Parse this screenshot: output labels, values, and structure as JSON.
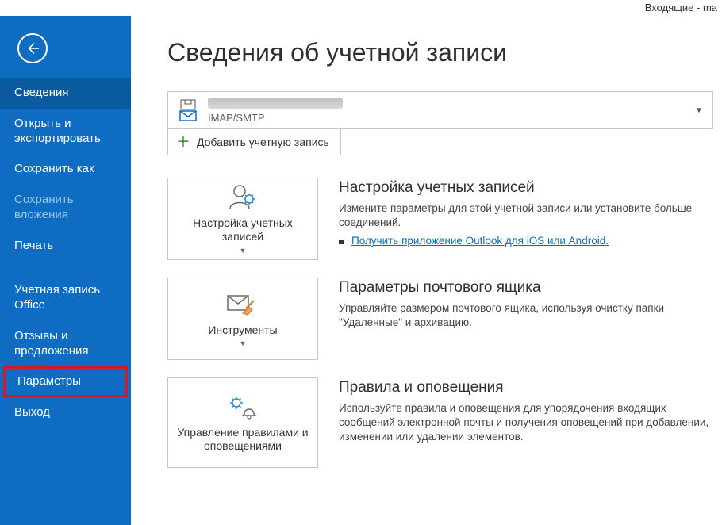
{
  "window": {
    "title": "Входящие - ma"
  },
  "sidebar": {
    "items": [
      {
        "label": "Сведения",
        "state": "selected"
      },
      {
        "label": "Открыть и экспортировать"
      },
      {
        "label": "Сохранить как"
      },
      {
        "label": "Сохранить вложения",
        "state": "disabled"
      },
      {
        "label": "Печать"
      }
    ],
    "footer_items": [
      {
        "label": "Учетная запись Office"
      },
      {
        "label": "Отзывы и предложения"
      },
      {
        "label": "Параметры",
        "state": "highlight"
      },
      {
        "label": "Выход"
      }
    ]
  },
  "main": {
    "title": "Сведения об учетной записи",
    "account": {
      "type_label": "IMAP/SMTP",
      "add_label": "Добавить учетную запись"
    },
    "cards": [
      {
        "button_label": "Настройка учетных записей",
        "title": "Настройка учетных записей",
        "text": "Измените параметры для этой учетной записи или установите больше соединений.",
        "link": "Получить приложение Outlook для iOS или Android."
      },
      {
        "button_label": "Инструменты",
        "title": "Параметры почтового ящика",
        "text": "Управляйте размером почтового ящика, используя очистку папки \"Удаленные\" и архивацию."
      },
      {
        "button_label": "Управление правилами и оповещениями",
        "title": "Правила и оповещения",
        "text": "Используйте правила и оповещения для упорядочения входящих сообщений электронной почты и получения оповещений при добавлении, изменении или удалении элементов."
      }
    ]
  }
}
